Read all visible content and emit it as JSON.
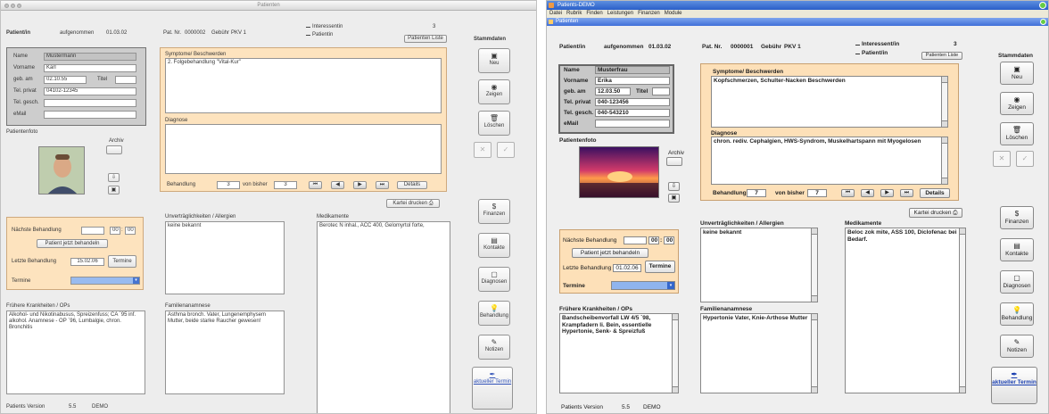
{
  "windows": [
    {
      "title": "Patienten",
      "header": {
        "patient_label": "Patient/in",
        "aufgenommen_label": "aufgenommen",
        "aufgenommen": "01.03.02",
        "patnr_label": "Pat. Nr.",
        "patnr": "0000002",
        "gebuehr_label": "Gebühr",
        "gebuehr": "PKV 1",
        "interessent": "Interessentin",
        "interessent_count": "3",
        "patientin": "Patientin",
        "list_button": "Patienten Liste"
      },
      "personal": {
        "name_label": "Name",
        "name": "Mustermann",
        "vorname_label": "Vorname",
        "vorname": "Karl",
        "geb_label": "geb. am",
        "geb": "02.10.55",
        "titel_label": "Titel",
        "titel": "",
        "telprivat_label": "Tel. privat",
        "telprivat": "04102-12345",
        "telgesch_label": "Tel. gesch.",
        "telgesch": "",
        "email_label": "eMail",
        "email": ""
      },
      "photo_label": "Patientenfoto",
      "archiv_label": "Archiv",
      "symptome_label": "Symptome/ Beschwerden",
      "symptome": "2. Folgebehandlung \"Vital-Kur\"",
      "diagnose_label": "Diagnose",
      "diagnose": "",
      "behandlung_label": "Behandlung",
      "behandlung": "3",
      "vonbisher_label": "von bisher",
      "vonbisher": "3",
      "nav": [
        "⏮",
        "◀",
        "▶",
        "⏭"
      ],
      "details": "Details",
      "kartei": "Kartei drucken",
      "naechste_label": "Nächste Behandlung",
      "time_h": "00",
      "time_m": "00",
      "jetzt_button": "Patient jetzt behandeln",
      "letzte_label": "Letzte Behandlung",
      "letzte": "15.02.06",
      "termine_button": "Termine",
      "termine_label": "Termine",
      "frueher_label": "Frühere Krankheiten / OPs",
      "frueher": "Alkohol- und Nikotinabusus, Spreizenfuss; CA `95 inf. alkohol. Anamnese - OP `96, Lumbalgie, chron. Bronchitis",
      "unvert_label": "Unverträglichkeiten / Allergien",
      "unvert": "keine bekannt",
      "familien_label": "Familienanamnese",
      "familien": "Asthma bronch. Vater, Lungenemphysem Mutter, beide starke Raucher gewesen!",
      "medik_label": "Medikamente",
      "medik": "Berotec N inhal., ACC 400, Gelomyrtol forte,",
      "stamm_label": "Stammdaten",
      "neu": "Neu",
      "zeigen": "Zeigen",
      "loeschen": "Löschen",
      "finanzen": "Finanzen",
      "kontakte": "Kontakte",
      "diagnosen": "Diagnosen",
      "behandlung_btn": "Behandlung",
      "notizen": "Notizen",
      "aktueller": "aktueller Termin",
      "footer_left": "Patients Version",
      "footer_ver": "5.5",
      "footer_demo": "DEMO"
    },
    {
      "title": "Patients-DEMO",
      "menu": [
        "Datei",
        "Rubrik",
        "Finden",
        "Leistungen",
        "Finanzen",
        "Module"
      ],
      "inner_title": "Patienten",
      "header": {
        "patient_label": "Patient/in",
        "aufgenommen_label": "aufgenommen",
        "aufgenommen": "01.03.02",
        "patnr_label": "Pat. Nr.",
        "patnr": "0000001",
        "gebuehr_label": "Gebühr",
        "gebuehr": "PKV 1",
        "interessent": "Interessent/in",
        "interessent_count": "3",
        "patientin": "Patient/in",
        "list_button": "Patienten Liste"
      },
      "personal": {
        "name_label": "Name",
        "name": "Musterfrau",
        "vorname_label": "Vorname",
        "vorname": "Erika",
        "geb_label": "geb. am",
        "geb": "12.03.50",
        "titel_label": "Titel",
        "titel": "",
        "telprivat_label": "Tel. privat",
        "telprivat": "040-123456",
        "telgesch_label": "Tel. gesch.",
        "telgesch": "040-543210",
        "email_label": "eMail",
        "email": ""
      },
      "photo_label": "Patientenfoto",
      "archiv_label": "Archiv",
      "symptome_label": "Symptome/ Beschwerden",
      "symptome": "Kopfschmerzen, Schulter-Nacken Beschwerden",
      "diagnose_label": "Diagnose",
      "diagnose": "chron. rediv. Cephalgien, HWS-Syndrom, Muskelhartspann mit Myogelosen",
      "behandlung_label": "Behandlung",
      "behandlung": "7",
      "vonbisher_label": "von bisher",
      "vonbisher": "7",
      "nav": [
        "⏮",
        "◀",
        "▶",
        "⏭"
      ],
      "details": "Details",
      "kartei": "Kartei drucken",
      "naechste_label": "Nächste Behandlung",
      "time_h": "00",
      "time_m": "00",
      "jetzt_button": "Patient jetzt behandeln",
      "letzte_label": "Letzte Behandlung",
      "letzte": "01.02.06",
      "termine_button": "Termine",
      "termine_label": "Termine",
      "frueher_label": "Frühere Krankheiten / OPs",
      "frueher": "Bandscheibenvorfall LW 4/5 `98, Krampfadern li. Bein, essentielle Hypertonie, Senk- & Spreizfuß",
      "unvert_label": "Unverträglichkeiten / Allergien",
      "unvert": "keine bekannt",
      "familien_label": "Familienanamnese",
      "familien": "Hypertonie Vater, Knie-Arthose Mutter",
      "medik_label": "Medikamente",
      "medik": "Beloc zok mite, ASS 100, Diclofenac bei Bedarf.",
      "stamm_label": "Stammdaten",
      "neu": "Neu",
      "zeigen": "Zeigen",
      "loeschen": "Löschen",
      "finanzen": "Finanzen",
      "kontakte": "Kontakte",
      "diagnosen": "Diagnosen",
      "behandlung_btn": "Behandlung",
      "notizen": "Notizen",
      "aktueller": "aktueller Termin",
      "footer_left": "Patients Version",
      "footer_ver": "5.5",
      "footer_demo": "DEMO"
    }
  ],
  "icons": {
    "neu": "floppy-icon",
    "zeigen": "eye-icon",
    "loeschen": "trash-icon",
    "finanzen": "dollar-icon",
    "kontakte": "contacts-icon",
    "diagnosen": "clipboard-icon",
    "behandlung": "bulb-icon",
    "notizen": "pencil-icon"
  },
  "colors": {
    "orange_panel": "#fde0b8",
    "gray_panel": "#c8c8c8",
    "termine_dropdown": "#8fb4ee",
    "link": "#1a3fb0"
  }
}
